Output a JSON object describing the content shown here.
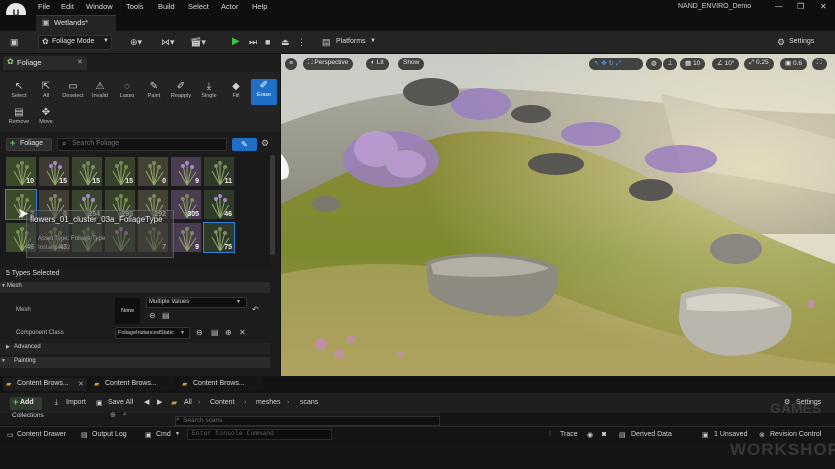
{
  "titlebar": {
    "logo": "U",
    "menu": [
      "File",
      "Edit",
      "Window",
      "Tools",
      "Build",
      "Select",
      "Actor",
      "Help"
    ],
    "project_name": "NAND_ENVIRO_Demo"
  },
  "level_tab": {
    "label": "Wetlands*"
  },
  "toolbar": {
    "mode_label": "Foliage Mode",
    "platforms_label": "Platforms",
    "settings_label": "Settings"
  },
  "foliage_panel": {
    "tab_label": "Foliage",
    "tools": [
      {
        "label": "Select",
        "icon": "↖"
      },
      {
        "label": "All",
        "icon": "⇱"
      },
      {
        "label": "Deselect",
        "icon": "▭"
      },
      {
        "label": "Invalid",
        "icon": "⚠"
      },
      {
        "label": "Lasso",
        "icon": "◌"
      },
      {
        "label": "Paint",
        "icon": "✎"
      },
      {
        "label": "Reapply",
        "icon": "✐"
      },
      {
        "label": "Single",
        "icon": "⤓"
      },
      {
        "label": "Fill",
        "icon": "◆"
      },
      {
        "label": "Erase",
        "icon": "✐"
      },
      {
        "label": "Remove",
        "icon": "▤"
      },
      {
        "label": "Move",
        "icon": "✥"
      }
    ],
    "add_foliage_label": "Foliage",
    "search_placeholder": "Search Foliage",
    "thumbnails": [
      {
        "count": "10"
      },
      {
        "count": "15"
      },
      {
        "count": "15"
      },
      {
        "count": "15"
      },
      {
        "count": "0"
      },
      {
        "count": "9"
      },
      {
        "count": "11"
      },
      {
        "count": "2"
      },
      {
        "count": "0"
      },
      {
        "count": "254"
      },
      {
        "count": "295"
      },
      {
        "count": "292"
      },
      {
        "count": "305"
      },
      {
        "count": "46"
      },
      {
        "count": "46"
      },
      {
        "count": "43"
      },
      {
        "count": ""
      },
      {
        "count": ""
      },
      {
        "count": "7"
      },
      {
        "count": "9"
      },
      {
        "count": "75"
      }
    ],
    "tooltip_title": "flowers_01_cluster_03a_FoliageType",
    "tooltip_sub": "Asset Type: Foliage Type",
    "tooltip_sub2": "Instances: 2",
    "types_selected": "5 Types Selected",
    "sections": {
      "mesh": "Mesh",
      "advanced": "Advanced",
      "painting": "Painting"
    },
    "mesh_row_label": "Mesh",
    "mesh_none": "None",
    "mesh_multiple": "Multiple Values",
    "component_class_label": "Component Class",
    "component_class_value": "FoliageInstancedStatic"
  },
  "viewport": {
    "perspective": "Perspective",
    "lit": "Lit",
    "show": "Show",
    "grid": "10",
    "angle": "10°",
    "scale": "0.25",
    "camera_speed": "0.6"
  },
  "content_browser": {
    "tabs": [
      "Content Brows...",
      "Content Brows...",
      "Content Brows..."
    ],
    "add": "Add",
    "import": "Import",
    "save_all": "Save All",
    "path": [
      "All",
      "Content",
      "meshes",
      "scans"
    ],
    "settings": "Settings",
    "collections": "Collections",
    "search_placeholder": "Search scans"
  },
  "statusbar": {
    "content_drawer": "Content Drawer",
    "output_log": "Output Log",
    "cmd": "Cmd",
    "console_placeholder": "Enter Console Command",
    "trace": "Trace",
    "derived_data": "Derived Data",
    "unsaved": "1 Unsaved",
    "revision_control": "Revision Control"
  },
  "watermark": {
    "top": "GAMES",
    "bottom": "WORKSHOP"
  }
}
